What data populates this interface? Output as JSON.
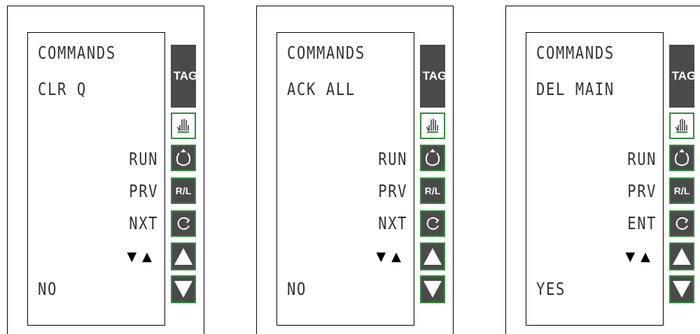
{
  "panels": [
    {
      "title": "COMMANDS",
      "command": "CLR Q",
      "softkeys": [
        "RUN",
        "PRV",
        "NXT"
      ],
      "arrows": "▼▲",
      "bottom": "NO"
    },
    {
      "title": "COMMANDS",
      "command": "ACK ALL",
      "softkeys": [
        "RUN",
        "PRV",
        "NXT"
      ],
      "arrows": "▼▲",
      "bottom": "NO"
    },
    {
      "title": "COMMANDS",
      "command": "DEL MAIN",
      "softkeys": [
        "RUN",
        "PRV",
        "ENT"
      ],
      "arrows": "▼▲",
      "bottom": "YES"
    }
  ],
  "keys": {
    "tag_label": "TAG",
    "rl_label": "R/L",
    "icons": [
      "hand-icon",
      "run-icon",
      "cycle-icon",
      "up-arrow-icon",
      "down-arrow-icon"
    ]
  },
  "colors": {
    "key_fill": "#4a4a4a",
    "key_border": "#2f8f36",
    "lcd_text": "#333333"
  }
}
